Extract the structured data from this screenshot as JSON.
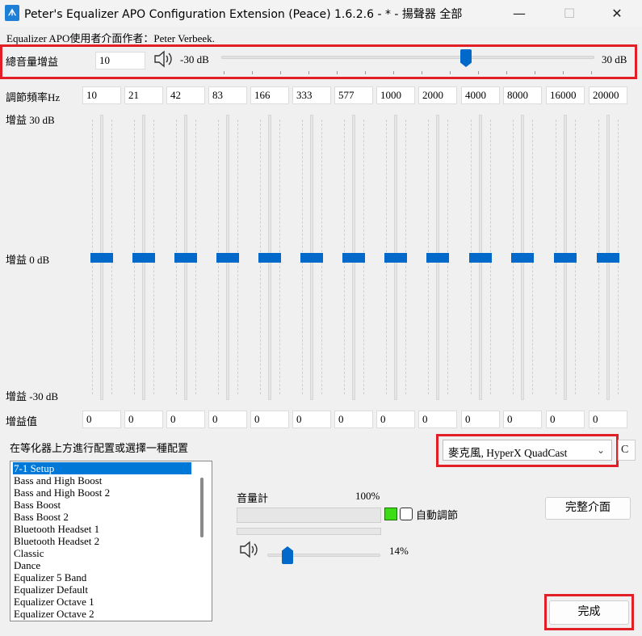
{
  "window": {
    "title": "Peter's Equalizer APO Configuration Extension (Peace) 1.6.2.6 - * - 揚聲器 全部",
    "icon_name": "peace-app-icon",
    "controls": {
      "minimize": "—",
      "maximize": "☐",
      "close": "✕"
    }
  },
  "author_line": "Equalizer APO使用者介面作者：Peter Verbeek.",
  "preamp": {
    "label": "總音量增益",
    "value": "10",
    "min_label": "-30 dB",
    "max_label": "30 dB",
    "slider_value_db": 10
  },
  "frequency_row": {
    "label": "調節頻率Hz",
    "values": [
      "10",
      "21",
      "42",
      "83",
      "166",
      "333",
      "577",
      "1000",
      "2000",
      "4000",
      "8000",
      "16000",
      "20000"
    ]
  },
  "gain_scale": {
    "top": "增益 30 dB",
    "middle": "增益 0 dB",
    "bottom": "增益 -30 dB"
  },
  "gain_row": {
    "label": "增益值",
    "values": [
      "0",
      "0",
      "0",
      "0",
      "0",
      "0",
      "0",
      "0",
      "0",
      "0",
      "0",
      "0",
      "0"
    ]
  },
  "preset_section": {
    "instruction": "在等化器上方進行配置或選擇一種配置",
    "device_select": "麥克風, HyperX QuadCast",
    "clipped_next_button": "C",
    "presets": [
      "7-1 Setup",
      "Bass and High Boost",
      "Bass and High Boost 2",
      "Bass Boost",
      "Bass Boost 2",
      "Bluetooth Headset 1",
      "Bluetooth Headset 2",
      "Classic",
      "Dance",
      "Equalizer 5 Band",
      "Equalizer Default",
      "Equalizer Octave 1",
      "Equalizer Octave 2"
    ],
    "selected_preset": "7-1 Setup"
  },
  "volume_meter": {
    "label": "音量計",
    "level_text": "100%",
    "auto_adjust_label": "自動調節",
    "volume_text": "14%",
    "volume_fraction": 0.14
  },
  "buttons": {
    "full_interface": "完整介面",
    "done": "完成"
  },
  "colors": {
    "accent": "#0069c9",
    "highlight_box": "#e21f26",
    "meter_green": "#3cdc16"
  }
}
